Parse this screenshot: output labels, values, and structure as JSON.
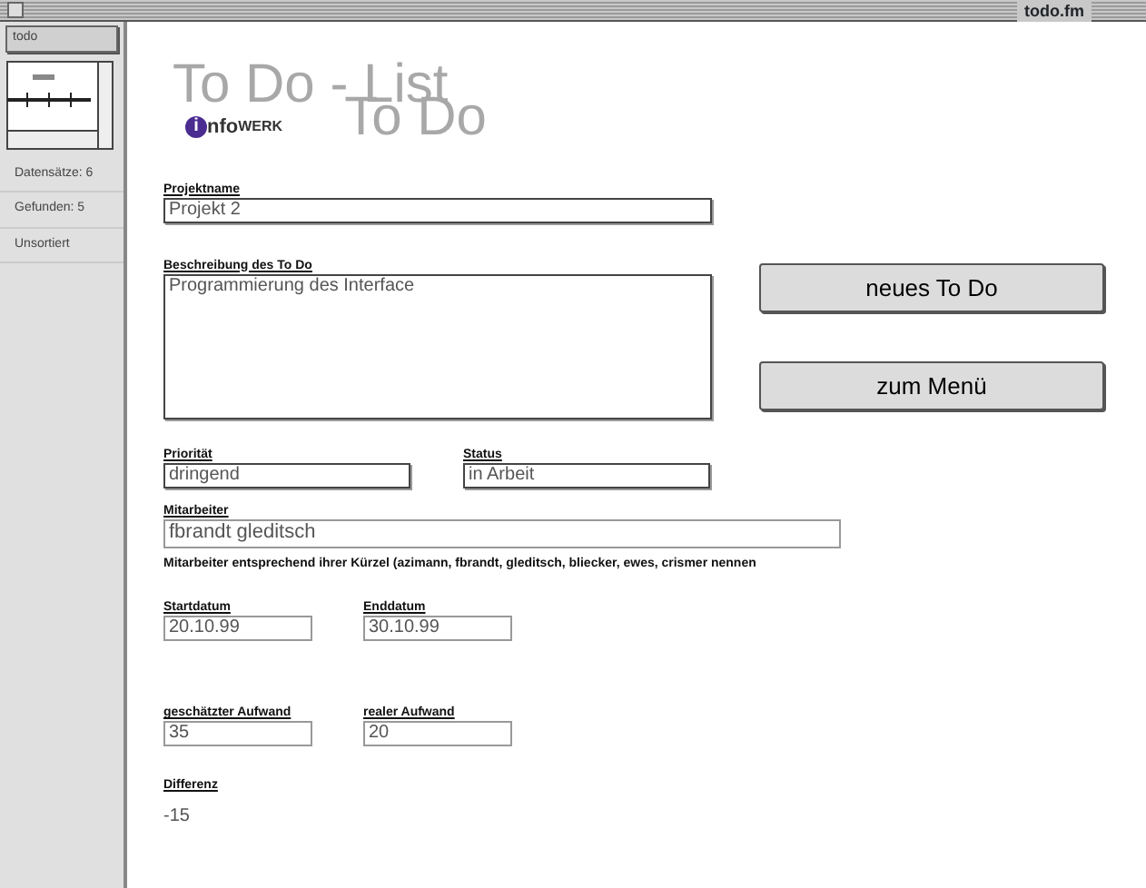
{
  "window": {
    "title": "todo.fm"
  },
  "sidebar": {
    "layout_menu": "todo",
    "record_count": "Datensätze: 6",
    "found_count": "Gefunden: 5",
    "sort_state": "Unsortiert"
  },
  "header": {
    "title": "To Do - List",
    "logo": {
      "mark": "i",
      "text_lower": "nfo",
      "text_upper": "WERK"
    },
    "subtitle": "To Do"
  },
  "fields": {
    "project": {
      "label": "Projektname",
      "value": "Projekt 2"
    },
    "description": {
      "label": "Beschreibung des To Do",
      "value": "Programmierung des Interface"
    },
    "priority": {
      "label": "Priorität",
      "value": "dringend"
    },
    "status": {
      "label": "Status",
      "value": "in Arbeit"
    },
    "staff": {
      "label": "Mitarbeiter",
      "value": "fbrandt gleditsch"
    },
    "staff_hint": "Mitarbeiter entsprechend ihrer Kürzel (azimann, fbrandt, gleditsch, bliecker, ewes, crismer nennen",
    "start": {
      "label": "Startdatum",
      "value": "20.10.99"
    },
    "end": {
      "label": "Enddatum",
      "value": "30.10.99"
    },
    "estimated": {
      "label": "geschätzter Aufwand",
      "value": "35"
    },
    "actual": {
      "label": "realer Aufwand",
      "value": "20"
    },
    "difference": {
      "label": "Differenz",
      "value": "-15"
    }
  },
  "buttons": [
    "neues To Do",
    "zum Menü"
  ]
}
